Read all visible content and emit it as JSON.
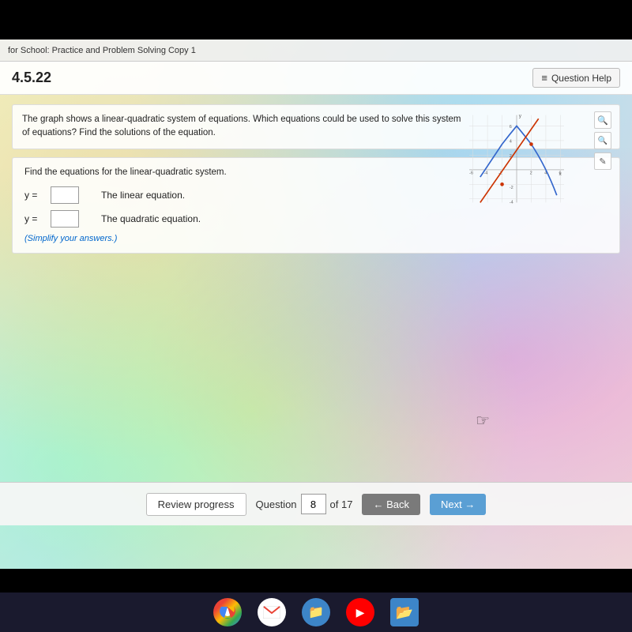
{
  "topbar": {
    "title": "for School: Practice and Problem Solving Copy 1"
  },
  "question": {
    "number": "4.5.22",
    "help_label": "Question Help",
    "problem_text": "The graph shows a linear-quadratic system of equations. Which equations could be used to solve this system of equations? Find the solutions of the equation.",
    "instruction": "Find the equations for the linear-quadratic system.",
    "linear_label": "y =",
    "quadratic_label": "y =",
    "linear_description": "The linear equation.",
    "quadratic_description": "The quadratic equation.",
    "simplify_note": "(Simplify your answers.)",
    "linear_value": "",
    "quadratic_value": ""
  },
  "navigation": {
    "review_label": "Review progress",
    "question_label": "Question",
    "question_current": "8",
    "question_total": "of 17",
    "back_label": "← Back",
    "next_label": "Next →"
  },
  "taskbar": {
    "icons": [
      "chrome",
      "gmail",
      "drive",
      "youtube",
      "files"
    ]
  },
  "icons": {
    "zoom_in": "🔍",
    "zoom_out": "🔍",
    "external": "✎",
    "menu": "≡"
  }
}
